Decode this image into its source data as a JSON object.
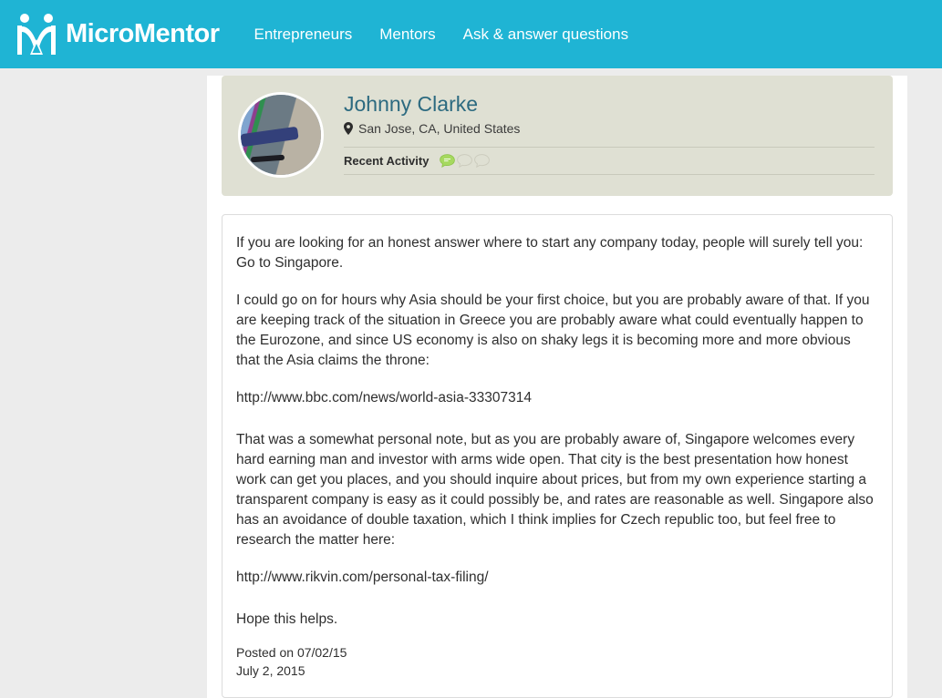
{
  "header": {
    "brand_name": "MicroMentor",
    "logo_icon": "micromentor-m-logo",
    "accent_color": "#1fb4d4",
    "nav": [
      {
        "label": "Entrepreneurs",
        "name": "nav-entrepreneurs"
      },
      {
        "label": "Mentors",
        "name": "nav-mentors"
      },
      {
        "label": "Ask & answer questions",
        "name": "nav-ask-answer-questions"
      }
    ]
  },
  "profile": {
    "name": "Johnny Clarke",
    "name_color": "#2c6a80",
    "location": "San Jose, CA, United States",
    "location_icon": "map-pin-icon",
    "avatar_icon": "user-avatar-photo",
    "activity_label": "Recent Activity",
    "activity_bubbles": [
      {
        "state": "filled",
        "color": "#a6d95f"
      },
      {
        "state": "empty",
        "color": "#d4d5c7"
      },
      {
        "state": "empty",
        "color": "#d4d5c7"
      }
    ],
    "card_background": "#dfe0d3"
  },
  "answer": {
    "paragraphs": [
      "If you are looking for an honest answer where to start any company today, people will surely tell you: Go to Singapore.",
      "I could go on for hours why Asia should be your first choice, but you are probably aware of that. If you are keeping track of the situation in Greece you are probably aware what could eventually happen to the Eurozone, and since US economy is also on shaky legs it is becoming more and more obvious that the Asia claims the throne:"
    ],
    "link_one": "http://www.bbc.com/news/world-asia-33307314",
    "paragraph_three": "That was a somewhat personal note, but as you are probably aware of, Singapore welcomes every hard earning man and investor with arms wide open. That city is the best presentation how honest work can get you places, and you should inquire about prices, but from my own experience starting a transparent company is easy as it could possibly be, and rates are reasonable as well. Singapore also has an avoidance of double taxation, which I think implies for Czech republic too, but feel free to research the matter here:",
    "link_two": "http://www.rikvin.com/personal-tax-filing/",
    "closing": "Hope this helps.",
    "posted_on": "Posted on 07/02/15",
    "posted_date": "July 2, 2015"
  }
}
